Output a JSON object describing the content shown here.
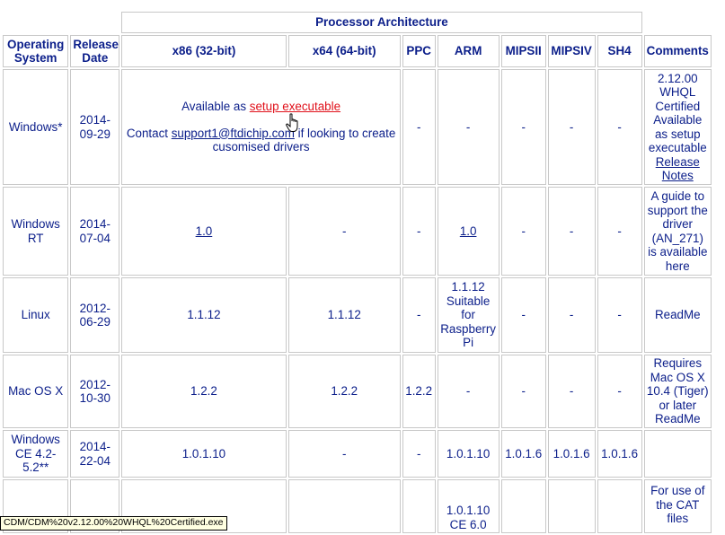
{
  "table": {
    "group_header": "Processor Architecture",
    "col_headers": {
      "os": "Operating System",
      "date": "Release Date",
      "x86": "x86 (32-bit)",
      "x64": "x64 (64-bit)",
      "ppc": "PPC",
      "arm": "ARM",
      "mipsii": "MIPSII",
      "mipsiv": "MIPSIV",
      "sh4": "SH4",
      "comments": "Comments"
    },
    "dash": "-",
    "rows": {
      "windows": {
        "os": "Windows*",
        "date": "2014-09-29",
        "avail_prefix": "Available as ",
        "setup_link": "setup executable",
        "contact_prefix": "Contact ",
        "email": "support1@ftdichip.com",
        "contact_suffix": " if looking to create cusomised drivers",
        "comment_text": "2.12.00 WHQL Certified Available as setup executable",
        "comment_link": "Release Notes"
      },
      "windows_rt": {
        "os": "Windows RT",
        "date": "2014-07-04",
        "x86": "1.0",
        "arm": "1.0",
        "comment_text": "A guide to support the driver (AN_271) is available",
        "comment_link": "here"
      },
      "linux": {
        "os": "Linux",
        "date": "2012-06-29",
        "x86": "1.1.12",
        "x64": "1.1.12",
        "arm": "1.1.12 Suitable for Raspberry Pi",
        "comment": "ReadMe"
      },
      "macos": {
        "os": "Mac OS X",
        "date": "2012-10-30",
        "x86": "1.2.2",
        "x64": "1.2.2",
        "ppc": "1.2.2",
        "comment_text": "Requires Mac OS X 10.4 (Tiger) or later",
        "comment_link": "ReadMe"
      },
      "wince": {
        "os": "Windows CE 4.2-5.2**",
        "date": "2014-22-04",
        "x86": "1.0.1.10",
        "arm": "1.0.1.10",
        "mipsii": "1.0.1.6",
        "mipsiv": "1.0.1.6",
        "sh4": "1.0.1.6"
      },
      "wince6": {
        "arm": "1.0.1.10 CE 6.0",
        "comment": "For use of the CAT files"
      }
    }
  },
  "status_bar": {
    "url": "CDM/CDM%20v2.12.00%20WHQL%20Certified.exe"
  }
}
